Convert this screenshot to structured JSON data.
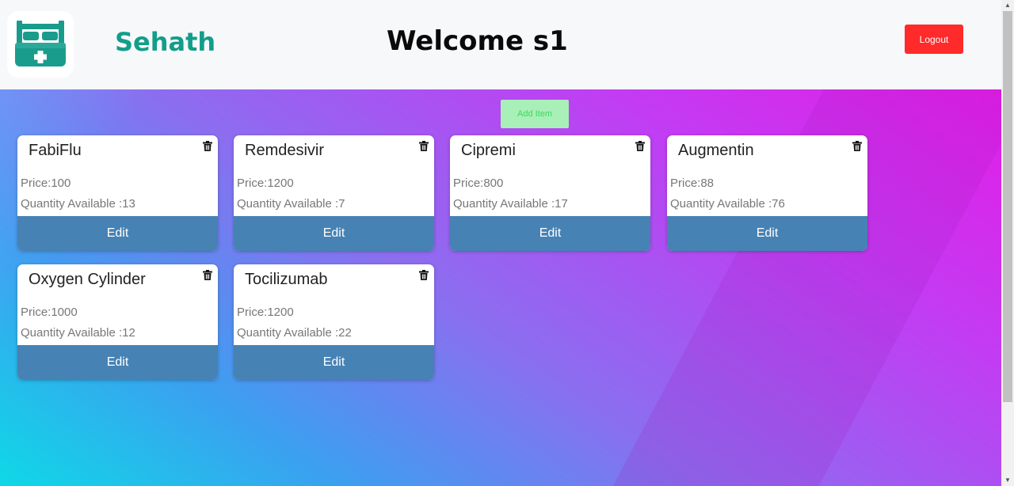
{
  "header": {
    "brand": "Sehath",
    "welcome": "Welcome s1",
    "logout_label": "Logout"
  },
  "toolbar": {
    "add_item_label": "Add Item"
  },
  "colors": {
    "brand": "#139d8a",
    "logout": "#ff2a2a",
    "edit": "#4682b4",
    "add_item_bg": "#a8f0b8",
    "add_item_text": "#3fd65e",
    "logo_teal": "#1a9c8c"
  },
  "items": [
    {
      "name": "FabiFlu",
      "price": "Price:100",
      "quantity": "Quantity Available :13",
      "edit_label": "Edit",
      "delete_icon": "trash-icon"
    },
    {
      "name": "Remdesivir",
      "price": "Price:1200",
      "quantity": "Quantity Available :7",
      "edit_label": "Edit",
      "delete_icon": "trash-icon"
    },
    {
      "name": "Cipremi",
      "price": "Price:800",
      "quantity": "Quantity Available :17",
      "edit_label": "Edit",
      "delete_icon": "trash-icon"
    },
    {
      "name": "Augmentin",
      "price": "Price:88",
      "quantity": "Quantity Available :76",
      "edit_label": "Edit",
      "delete_icon": "trash-icon"
    },
    {
      "name": "Oxygen Cylinder",
      "price": "Price:1000",
      "quantity": "Quantity Available :12",
      "edit_label": "Edit",
      "delete_icon": "trash-icon"
    },
    {
      "name": "Tocilizumab",
      "price": "Price:1200",
      "quantity": "Quantity Available :22",
      "edit_label": "Edit",
      "delete_icon": "trash-icon"
    }
  ]
}
